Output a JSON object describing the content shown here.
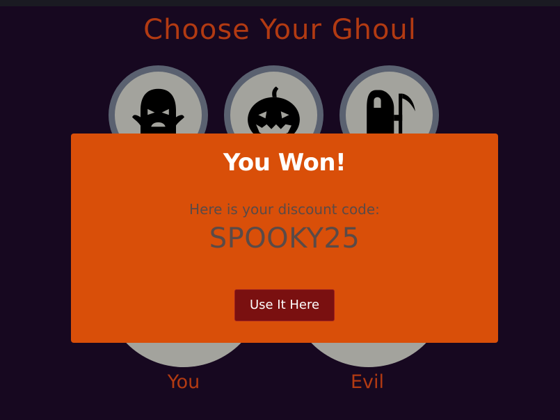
{
  "page": {
    "title": "Choose Your Ghoul"
  },
  "choices": [
    {
      "icon": "ghost-icon"
    },
    {
      "icon": "pumpkin-icon"
    },
    {
      "icon": "reaper-icon"
    }
  ],
  "players": {
    "you_label": "You",
    "opponent_label": "Evil"
  },
  "modal": {
    "heading": "You Won!",
    "message": "Here is your discount code:",
    "code": "SPOOKY25",
    "button_label": "Use It Here"
  },
  "colors": {
    "background": "#170820",
    "title": "#b23a12",
    "modal": "#d94f09",
    "button": "#7a1010",
    "circle": "#a3a39d"
  }
}
